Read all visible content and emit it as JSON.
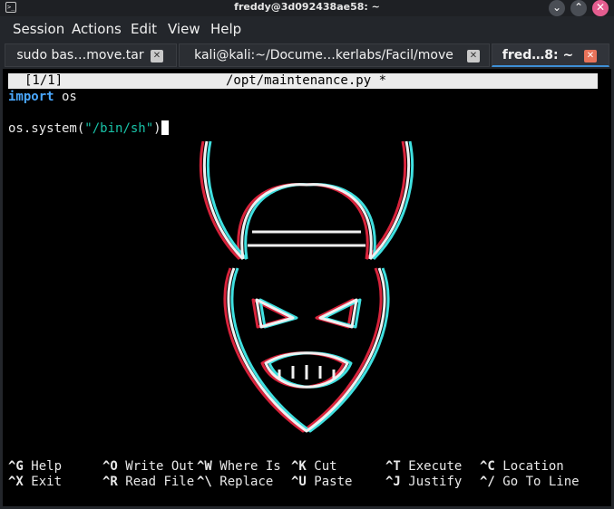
{
  "window": {
    "title": "freddy@3d092438ae58: ~",
    "min_icon": "minimize-icon",
    "max_icon": "maximize-icon",
    "close_icon": "close-icon",
    "close_color": "#e45d8f"
  },
  "menubar": {
    "items": [
      "Session",
      "Actions",
      "Edit",
      "View",
      "Help"
    ]
  },
  "tabs": [
    {
      "label": "sudo bas…move.tar",
      "active": false
    },
    {
      "label": "kali@kali:~/Docume…kerlabs/Facil/move",
      "active": false
    },
    {
      "label": "fred…8: ~",
      "active": true
    }
  ],
  "editor": {
    "position": "[1/1]",
    "filename": "/opt/maintenance.py *",
    "lines": {
      "l1_kw": "import",
      "l1_rest": " os",
      "l3_pre": "os.system(",
      "l3_str": "\"/bin/sh\"",
      "l3_post": ")"
    }
  },
  "shortcuts": [
    {
      "key": "^G",
      "label": "Help"
    },
    {
      "key": "^O",
      "label": "Write Out"
    },
    {
      "key": "^W",
      "label": "Where Is"
    },
    {
      "key": "^K",
      "label": "Cut"
    },
    {
      "key": "^T",
      "label": "Execute"
    },
    {
      "key": "^C",
      "label": "Location"
    },
    {
      "key": "^X",
      "label": "Exit"
    },
    {
      "key": "^R",
      "label": "Read File"
    },
    {
      "key": "^\\",
      "label": "Replace"
    },
    {
      "key": "^U",
      "label": "Paste"
    },
    {
      "key": "^J",
      "label": "Justify"
    },
    {
      "key": "^/",
      "label": "Go To Line"
    }
  ],
  "colors": {
    "accent": "#3e8fd6",
    "keyword": "#4aa8ff",
    "string": "#19c3a8",
    "glitch_red": "#d8243c",
    "glitch_cyan": "#3fe0e0"
  }
}
